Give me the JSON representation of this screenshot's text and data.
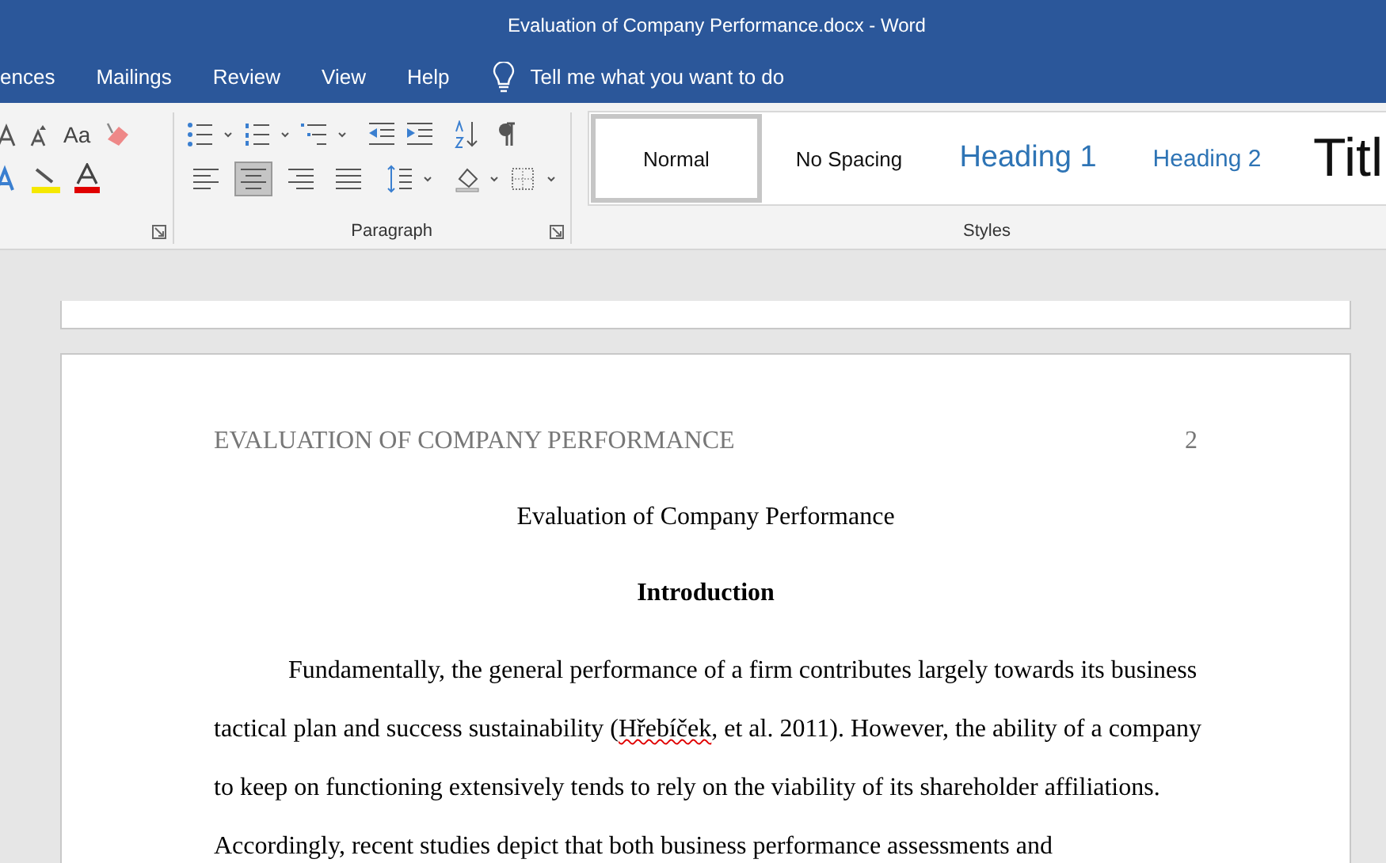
{
  "window": {
    "title": "Evaluation of Company Performance.docx  -  Word"
  },
  "ribbon_tabs": [
    {
      "label": "ences",
      "selected": false
    },
    {
      "label": "Mailings",
      "selected": false
    },
    {
      "label": "Review",
      "selected": false
    },
    {
      "label": "View",
      "selected": false
    },
    {
      "label": "Help",
      "selected": false
    }
  ],
  "tell_me": {
    "placeholder": "Tell me what you want to do"
  },
  "font_group": {
    "change_case": "Aa"
  },
  "paragraph_group": {
    "label": "Paragraph",
    "alignment": [
      {
        "kind": "left",
        "selected": false
      },
      {
        "kind": "center",
        "selected": true
      },
      {
        "kind": "right",
        "selected": false
      },
      {
        "kind": "justify",
        "selected": false
      }
    ]
  },
  "styles_group": {
    "label": "Styles",
    "styles": [
      {
        "kind": "normal",
        "label": "Normal",
        "selected": true
      },
      {
        "kind": "plain",
        "label": "No Spacing",
        "selected": false
      },
      {
        "kind": "heading1",
        "label": "Heading 1",
        "selected": false
      },
      {
        "kind": "heading2",
        "label": "Heading 2",
        "selected": false
      },
      {
        "kind": "title",
        "label": "Titl",
        "selected": false
      }
    ]
  },
  "document": {
    "header": "EVALUATION OF COMPANY PERFORMANCE",
    "page_number": "2",
    "title": "Evaluation of Company Performance",
    "heading": "Introduction",
    "paragraph": [
      {
        "text": "Fundamentally, the general performance of a firm contributes largely towards its business tactical plan and success sustainability (",
        "spelling_error": false
      },
      {
        "text": "Hřebíček",
        "spelling_error": true
      },
      {
        "text": ", et al. 2011). However, the ability of a company to keep on functioning extensively tends to rely on the viability of its shareholder affiliations. Accordingly, recent studies depict that both business performance assessments and",
        "spelling_error": false
      }
    ]
  }
}
